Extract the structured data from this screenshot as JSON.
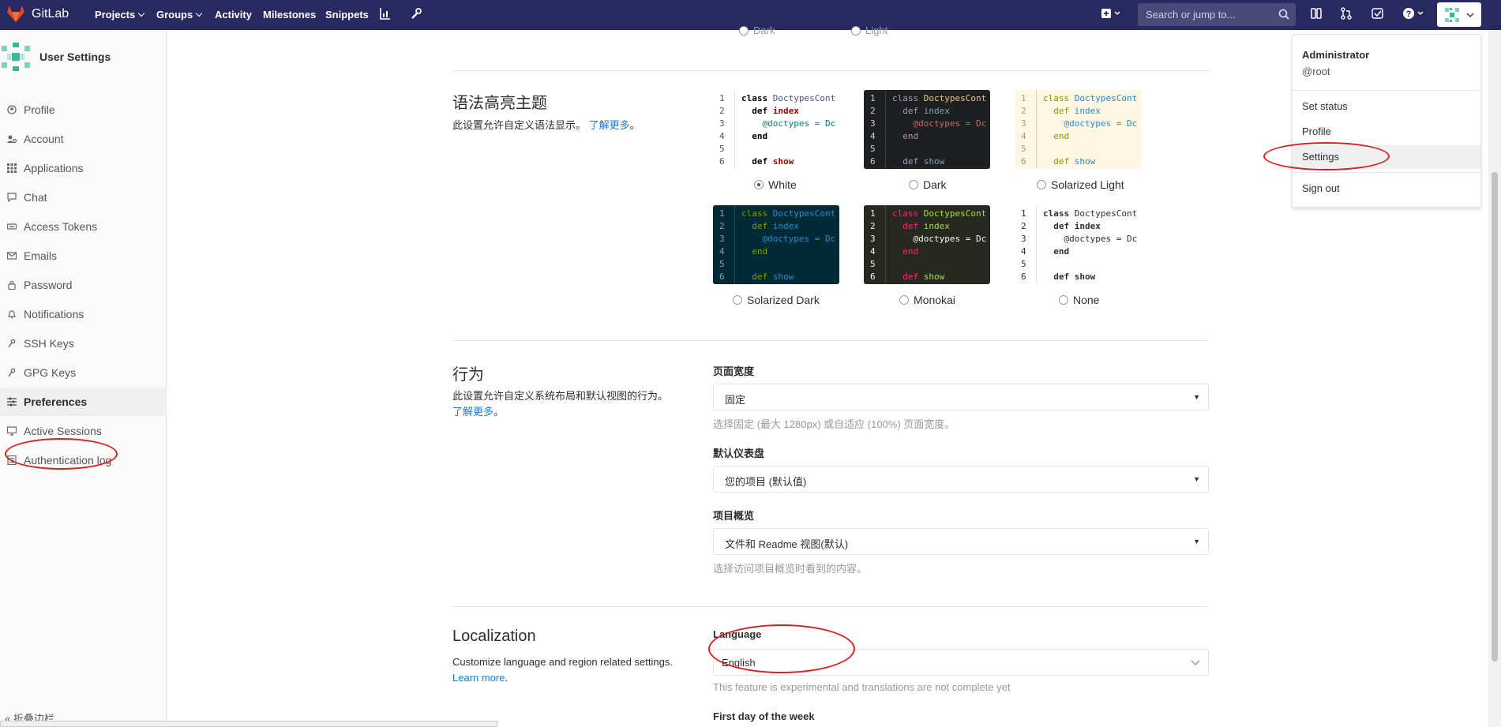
{
  "navbar": {
    "brand": "GitLab",
    "items": [
      "Projects",
      "Groups",
      "Activity",
      "Milestones",
      "Snippets"
    ],
    "search_placeholder": "Search or jump to..."
  },
  "sidebar": {
    "title": "User Settings",
    "items": [
      {
        "label": "Profile",
        "icon": "user-icon"
      },
      {
        "label": "Account",
        "icon": "account-icon"
      },
      {
        "label": "Applications",
        "icon": "grid-icon"
      },
      {
        "label": "Chat",
        "icon": "chat-icon"
      },
      {
        "label": "Access Tokens",
        "icon": "token-icon"
      },
      {
        "label": "Emails",
        "icon": "mail-icon"
      },
      {
        "label": "Password",
        "icon": "lock-icon"
      },
      {
        "label": "Notifications",
        "icon": "bell-icon"
      },
      {
        "label": "SSH Keys",
        "icon": "key-icon"
      },
      {
        "label": "GPG Keys",
        "icon": "key-icon"
      },
      {
        "label": "Preferences",
        "icon": "preferences-icon"
      },
      {
        "label": "Active Sessions",
        "icon": "monitor-icon"
      },
      {
        "label": "Authentication log",
        "icon": "log-icon"
      }
    ],
    "collapse_label": "折叠边栏"
  },
  "top_partial": {
    "dark": "Dark",
    "light": "Light"
  },
  "syntax": {
    "title": "语法高亮主题",
    "desc": "此设置允许自定义语法显示。",
    "learn_more": "了解更多",
    "period": "。",
    "code_lines": [
      "class DoctypesCont",
      "  def index",
      "    @doctypes = Dc",
      "  end",
      "",
      "  def show"
    ],
    "themes": [
      {
        "label": "White",
        "selected": true
      },
      {
        "label": "Dark",
        "selected": false
      },
      {
        "label": "Solarized Light",
        "selected": false
      },
      {
        "label": "Solarized Dark",
        "selected": false
      },
      {
        "label": "Monokai",
        "selected": false
      },
      {
        "label": "None",
        "selected": false
      }
    ]
  },
  "behavior": {
    "title": "行为",
    "desc": "此设置允许自定义系统布局和默认视图的行为。",
    "learn_more": "了解更多",
    "period": "。",
    "layout_label": "页面宽度",
    "layout_value": "固定",
    "layout_help": "选择固定 (最大 1280px) 或自适应 (100%) 页面宽度。",
    "dashboard_label": "默认仪表盘",
    "dashboard_value": "您的项目 (默认值)",
    "overview_label": "项目概览",
    "overview_value": "文件和 Readme 视图(默认)",
    "overview_help": "选择访问项目概览时看到的内容。"
  },
  "localization": {
    "title": "Localization",
    "desc": "Customize language and region related settings.",
    "learn_more": "Learn more",
    "period": ".",
    "language_label": "Language",
    "language_value": "English",
    "language_help": "This feature is experimental and translations are not complete yet",
    "first_day_label": "First day of the week"
  },
  "user_dropdown": {
    "name": "Administrator",
    "username": "@root",
    "items": [
      "Set status",
      "Profile",
      "Settings",
      "Sign out"
    ]
  },
  "colors": {
    "navbar": "#292961",
    "link": "#1f78d1",
    "annotation": "#d92020"
  }
}
